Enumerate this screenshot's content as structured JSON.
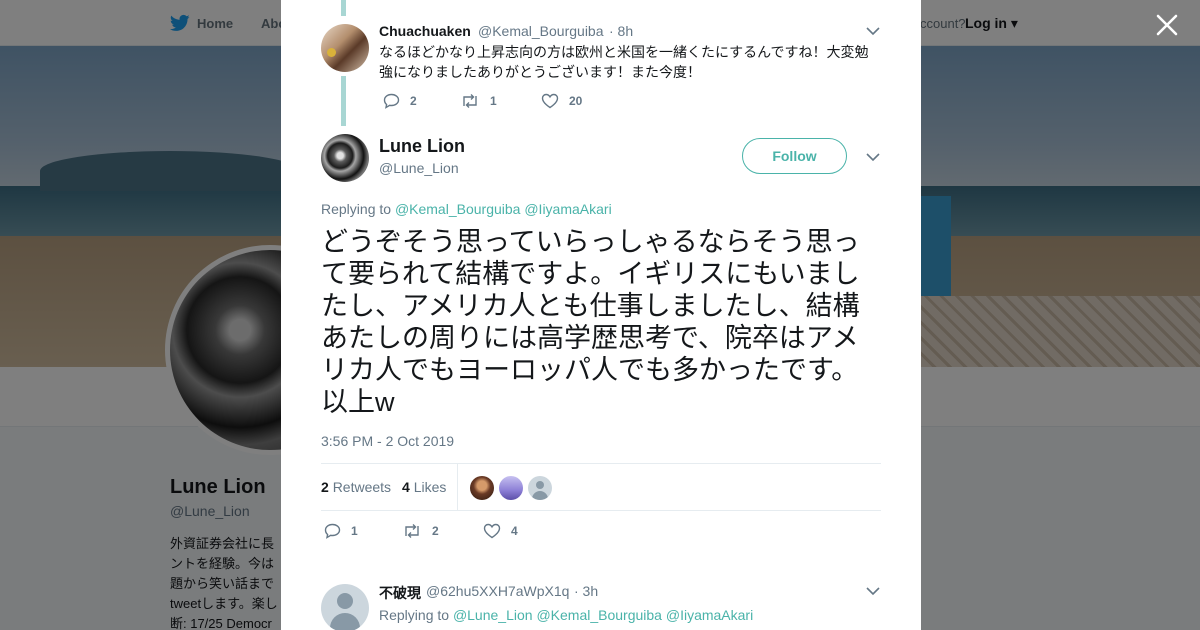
{
  "background": {
    "nav": {
      "home": "Home",
      "about": "Abo",
      "account_prompt": "ccount?",
      "login": "Log in"
    },
    "profile": {
      "name": "Lune Lion",
      "handle": "@Lune_Lion",
      "bio_lines": [
        "外資証券会社に長",
        "ントを経験。今は",
        "題から笑い話まで",
        "tweetします。楽し",
        "断: 17/25 Democr"
      ]
    }
  },
  "modal": {
    "parent_tweet": {
      "name": "Chuachuaken",
      "handle": "@Kemal_Bourguiba",
      "time": "· 8h",
      "text": "なるほどかなり上昇志向の方は欧州と米国を一緒くたにするんですね！大変勉強になりましたありがとうございます！また今度！",
      "replies": "2",
      "retweets": "1",
      "likes": "20"
    },
    "main_tweet": {
      "name": "Lune Lion",
      "handle": "@Lune_Lion",
      "follow_label": "Follow",
      "replying_prefix": "Replying to",
      "replying_mentions": [
        "@Kemal_Bourguiba",
        "@IiyamaAkari"
      ],
      "text": "どうぞそう思っていらっしゃるならそう思って要られて結構ですよ。イギリスにもいましたし、アメリカ人とも仕事しましたし、結構あたしの周りには高学歴思考で、院卒はアメリカ人でもヨーロッパ人でも多かったです。以上w",
      "timestamp": "3:56 PM - 2 Oct 2019",
      "retweets_count": "2",
      "retweets_label": "Retweets",
      "likes_count": "4",
      "likes_label": "Likes",
      "replies": "1",
      "retweets": "2",
      "likes": "4"
    },
    "reply_tweet": {
      "name": "不破現",
      "handle": "@62hu5XXH7aWpX1q",
      "time": "· 3h",
      "replying_prefix": "Replying to",
      "replying_mentions": [
        "@Lune_Lion",
        "@Kemal_Bourguiba",
        "@IiyamaAkari"
      ]
    }
  },
  "colors": {
    "accent": "#4ab3a9",
    "twitter_blue": "#1da1f2",
    "muted": "#657786",
    "thread_line": "#a8d6d3"
  }
}
